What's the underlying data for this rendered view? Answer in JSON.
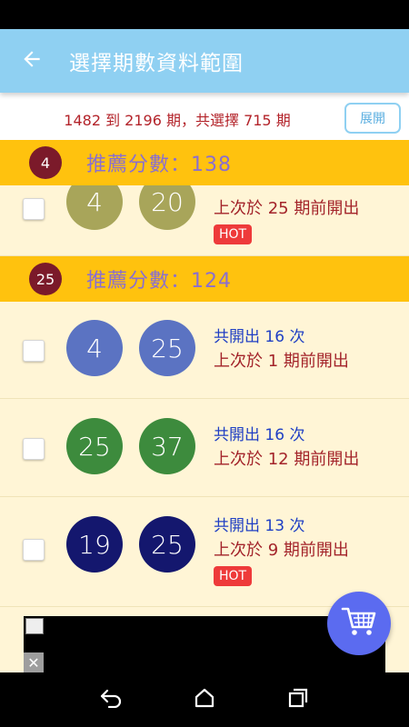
{
  "app_bar": {
    "title": "選擇期數資料範圍",
    "back_icon": "arrow-left-icon"
  },
  "range": {
    "text": "1482 到 2196 期，共選擇 715 期",
    "expand_label": "展開"
  },
  "groups": [
    {
      "badge": "4",
      "score": "推薦分數：138",
      "rows": [
        {
          "balls": [
            "4",
            "20"
          ],
          "ball_color": "#a8a55a",
          "total": "",
          "last": "上次於 25 期前開出",
          "hot": "HOT"
        }
      ]
    },
    {
      "badge": "25",
      "score": "推薦分數：124",
      "rows": [
        {
          "balls": [
            "4",
            "25"
          ],
          "ball_color": "#5b73c2",
          "total": "共開出 16 次",
          "last": "上次於 1 期前開出",
          "hot": ""
        },
        {
          "balls": [
            "25",
            "37"
          ],
          "ball_color": "#3d8b3d",
          "total": "共開出 16 次",
          "last": "上次於 12 期前開出",
          "hot": ""
        },
        {
          "balls": [
            "19",
            "25"
          ],
          "ball_color": "#14176e",
          "total": "共開出 13 次",
          "last": "上次於 9 期前開出",
          "hot": "HOT"
        }
      ]
    }
  ],
  "ad": {
    "close_label": "✕"
  },
  "fab": {
    "icon": "shopping-cart-icon"
  },
  "nav": {
    "back": "nav-back-icon",
    "home": "nav-home-icon",
    "recents": "nav-recents-icon"
  }
}
